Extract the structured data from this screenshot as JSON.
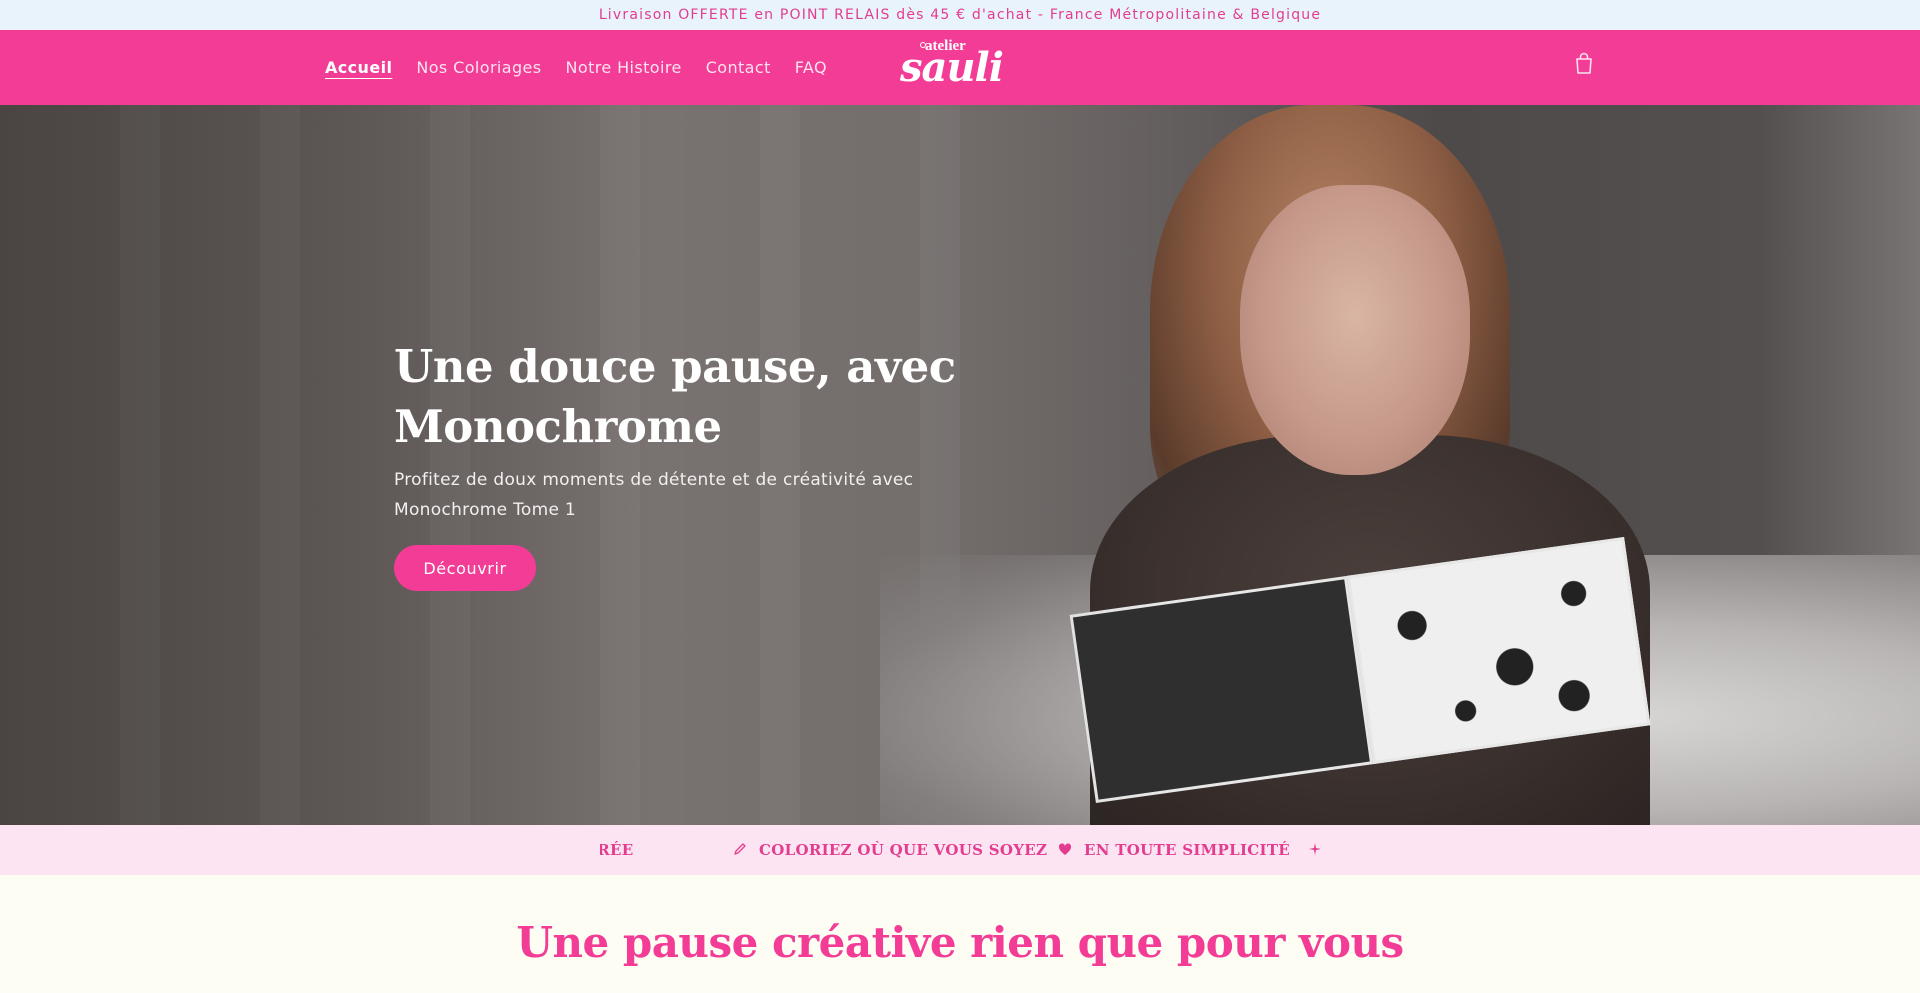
{
  "announcement": {
    "text": "Livraison OFFERTE en POINT RELAIS dès 45 € d'achat - France Métropolitaine & Belgique"
  },
  "header": {
    "nav": [
      {
        "label": "Accueil",
        "active": true
      },
      {
        "label": "Nos Coloriages",
        "active": false
      },
      {
        "label": "Notre Histoire",
        "active": false
      },
      {
        "label": "Contact",
        "active": false
      },
      {
        "label": "FAQ",
        "active": false
      }
    ],
    "logo": {
      "small": "atelier",
      "big": "sauli"
    },
    "cart_icon": "shopping-bag-icon",
    "brand_color": "#f23c95"
  },
  "hero": {
    "title": "Une douce pause, avec Monochrome",
    "text": "Profitez de doux moments de détente et de créativité avec Monochrome Tome 1",
    "button_label": "Découvrir"
  },
  "marquee": {
    "items": [
      {
        "icon": "",
        "text": "ASSURÉE"
      },
      {
        "icon": "pencil-icon",
        "text": "COLORIEZ OÙ QUE VOUS SOYEZ"
      },
      {
        "icon": "heart-icon",
        "text": "EN TOUTE SIMPLICITÉ"
      }
    ],
    "accent_color": "#e23d8f",
    "background": "#fde4f2"
  },
  "section": {
    "title": "Une pause créative rien que pour vous"
  }
}
